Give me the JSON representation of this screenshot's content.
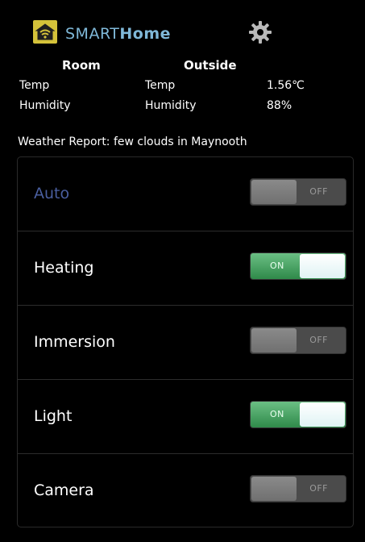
{
  "header": {
    "brand_smart": "SMART",
    "brand_home": "Home",
    "logo_icon": "wifi-house-icon",
    "settings_icon": "gear-icon"
  },
  "readings": {
    "room_heading": "Room",
    "outside_heading": "Outside",
    "room": {
      "temp_label": "Temp",
      "humidity_label": "Humidity",
      "temp_value": "",
      "humidity_value": ""
    },
    "outside": {
      "temp_label": "Temp",
      "humidity_label": "Humidity",
      "temp_value": "1.56℃",
      "humidity_value": "88%"
    }
  },
  "weather_report": "Weather Report: few clouds in Maynooth",
  "controls": [
    {
      "label": "Auto",
      "state": "off",
      "state_text": "OFF",
      "muted": true
    },
    {
      "label": "Heating",
      "state": "on",
      "state_text": "ON",
      "muted": false
    },
    {
      "label": "Immersion",
      "state": "off",
      "state_text": "OFF",
      "muted": false
    },
    {
      "label": "Light",
      "state": "on",
      "state_text": "ON",
      "muted": false
    },
    {
      "label": "Camera",
      "state": "off",
      "state_text": "OFF",
      "muted": false
    }
  ],
  "colors": {
    "brand": "#7fb8d8",
    "on_green": "#3c9a57",
    "off_grey": "#4b4b4b",
    "logo_yellow": "#d4c23a"
  }
}
